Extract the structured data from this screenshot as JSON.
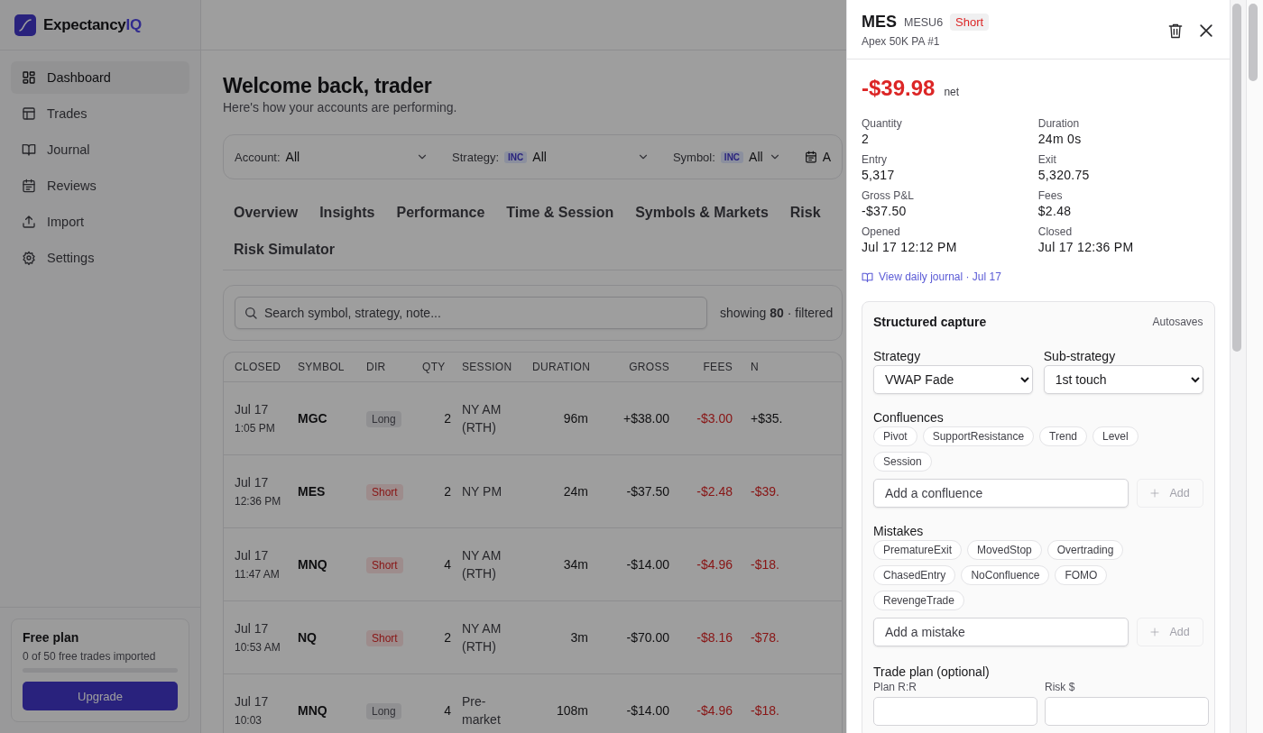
{
  "brand": {
    "name": "Expectancy",
    "accent": "IQ"
  },
  "sidebar": {
    "items": [
      {
        "label": "Dashboard",
        "selected": true
      },
      {
        "label": "Trades",
        "selected": false
      },
      {
        "label": "Journal",
        "selected": false
      },
      {
        "label": "Reviews",
        "selected": false
      },
      {
        "label": "Import",
        "selected": false
      },
      {
        "label": "Settings",
        "selected": false
      }
    ],
    "plan": {
      "title": "Free plan",
      "subtitle": "0 of 50 free trades imported",
      "level": 0,
      "button": "Upgrade"
    }
  },
  "header": {
    "title": "Welcome back, trader",
    "subtitle": "Here's how your accounts are performing."
  },
  "filters": [
    {
      "label": "Account:",
      "value": "All"
    },
    {
      "label": "Strategy:",
      "badge": "INC",
      "value": "All"
    },
    {
      "label": "Symbol:",
      "badge": "INC",
      "value": "All"
    }
  ],
  "date_filter": {
    "value": "A"
  },
  "tabs": [
    "Overview",
    "Insights",
    "Performance",
    "Time & Session",
    "Symbols & Markets",
    "Risk",
    "Risk Simulator"
  ],
  "search": {
    "placeholder": "Search symbol, strategy, note...",
    "showing_label": "showing",
    "showing_count": "80",
    "filtered_label": "· filtered"
  },
  "table": {
    "columns": [
      "CLOSED",
      "SYMBOL",
      "DIR",
      "QTY",
      "SESSION",
      "DURATION",
      "GROSS",
      "FEES",
      "N"
    ],
    "rows": [
      {
        "date": "Jul 17",
        "time": "1:05 PM",
        "symbol": "MGC",
        "dir": "Long",
        "dir_short": false,
        "qty": "2",
        "session": "NY AM (RTH)",
        "duration": "96m",
        "gross": "+$38.00",
        "fees": "-$3.00",
        "net": "+$35.",
        "net_loss": false
      },
      {
        "date": "Jul 17",
        "time": "12:36 PM",
        "symbol": "MES",
        "dir": "Short",
        "dir_short": true,
        "qty": "2",
        "session": "NY PM",
        "duration": "24m",
        "gross": "-$37.50",
        "fees": "-$2.48",
        "net": "-$39.",
        "net_loss": true
      },
      {
        "date": "Jul 17",
        "time": "11:47 AM",
        "symbol": "MNQ",
        "dir": "Short",
        "dir_short": true,
        "qty": "4",
        "session": "NY AM (RTH)",
        "duration": "34m",
        "gross": "-$14.00",
        "fees": "-$4.96",
        "net": "-$18.",
        "net_loss": true
      },
      {
        "date": "Jul 17",
        "time": "10:53 AM",
        "symbol": "NQ",
        "dir": "Short",
        "dir_short": true,
        "qty": "2",
        "session": "NY AM (RTH)",
        "duration": "3m",
        "gross": "-$70.00",
        "fees": "-$8.16",
        "net": "-$78.",
        "net_loss": true
      },
      {
        "date": "Jul 17",
        "time": "10:03",
        "symbol": "MNQ",
        "dir": "Long",
        "dir_short": false,
        "qty": "4",
        "session": "Pre-market",
        "duration": "108m",
        "gross": "-$14.00",
        "fees": "-$4.96",
        "net": "-$18.",
        "net_loss": true
      }
    ]
  },
  "drawer": {
    "symbol": "MES",
    "contract": "MESU6",
    "direction": "Short",
    "direction_short": true,
    "account": "Apex 50K PA #1",
    "net": "-$39.98",
    "net_label": "net",
    "net_loss": true,
    "stats": [
      {
        "label": "Quantity",
        "value": "2"
      },
      {
        "label": "Duration",
        "value": "24m 0s"
      },
      {
        "label": "Entry",
        "value": "5,317"
      },
      {
        "label": "Exit",
        "value": "5,320.75"
      },
      {
        "label": "Gross P&L",
        "value": "-$37.50"
      },
      {
        "label": "Fees",
        "value": "$2.48"
      },
      {
        "label": "Opened",
        "value": "Jul 17 12:12 PM"
      },
      {
        "label": "Closed",
        "value": "Jul 17 12:36 PM"
      }
    ],
    "journal_link": "View daily journal · Jul 17",
    "capture": {
      "title": "Structured capture",
      "status": "Autosaves",
      "selects": [
        {
          "label": "Strategy",
          "value": "VWAP Fade"
        },
        {
          "label": "Sub-strategy",
          "value": "1st touch"
        }
      ],
      "groups": [
        {
          "title": "Confluences",
          "tags": [
            "Pivot",
            "SupportResistance",
            "Trend",
            "Level",
            "Session"
          ],
          "placeholder": "Add a confluence",
          "add": "Add",
          "add_disabled": true
        },
        {
          "title": "Mistakes",
          "tags": [
            "PrematureExit",
            "MovedStop",
            "Overtrading",
            "ChasedEntry",
            "NoConfluence",
            "FOMO",
            "RevengeTrade"
          ],
          "placeholder": "Add a mistake",
          "add": "Add",
          "add_disabled": true
        }
      ],
      "plan": {
        "title": "Trade plan (optional)",
        "fields": [
          "Plan R:R",
          "Risk $"
        ]
      }
    }
  }
}
